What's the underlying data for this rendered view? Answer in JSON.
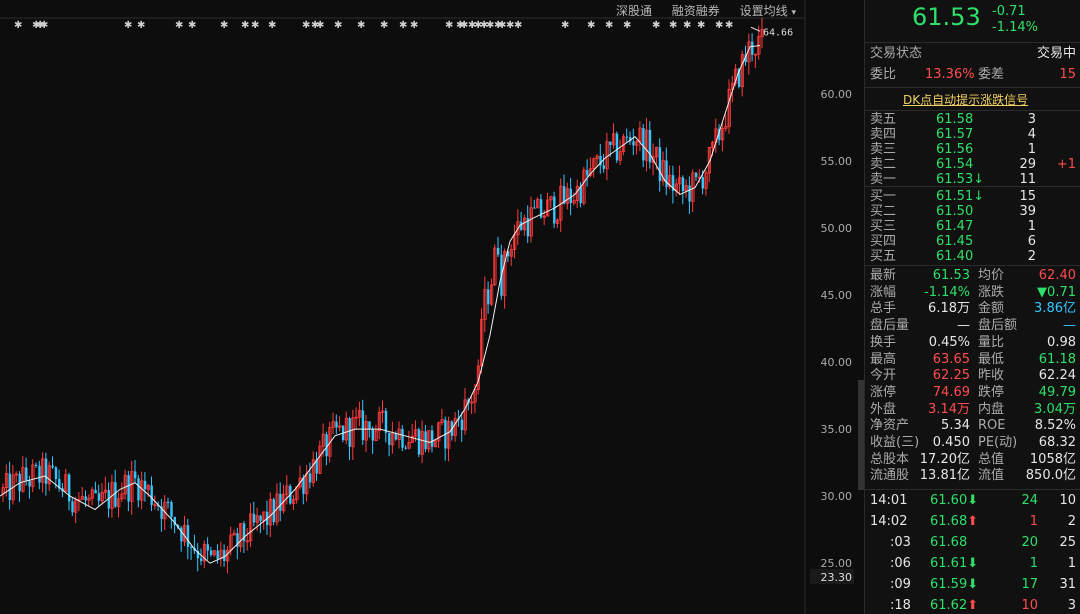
{
  "toolbar": {
    "links": [
      "深股通",
      "融资融券",
      "设置均线"
    ]
  },
  "chart_data": {
    "type": "candlestick",
    "y_ticks": [
      "60.00",
      "55.00",
      "50.00",
      "45.00",
      "40.00",
      "35.00",
      "30.00",
      "25.00"
    ],
    "y_min": 23.0,
    "y_max": 65.5,
    "low_label": "23.30",
    "high_label": "64.66",
    "ma_points": [
      [
        0,
        30.0
      ],
      [
        20,
        31.0
      ],
      [
        45,
        31.5
      ],
      [
        70,
        30.0
      ],
      [
        95,
        29.0
      ],
      [
        120,
        30.5
      ],
      [
        135,
        31.0
      ],
      [
        150,
        30.0
      ],
      [
        175,
        28.0
      ],
      [
        195,
        26.0
      ],
      [
        210,
        25.0
      ],
      [
        225,
        25.5
      ],
      [
        245,
        27.0
      ],
      [
        270,
        28.5
      ],
      [
        295,
        30.5
      ],
      [
        315,
        32.5
      ],
      [
        335,
        34.5
      ],
      [
        355,
        35.0
      ],
      [
        380,
        35.0
      ],
      [
        405,
        34.5
      ],
      [
        430,
        34.0
      ],
      [
        450,
        34.8
      ],
      [
        465,
        36.5
      ],
      [
        478,
        38.5
      ],
      [
        490,
        42.0
      ],
      [
        500,
        46.0
      ],
      [
        510,
        49.0
      ],
      [
        520,
        50.2
      ],
      [
        535,
        50.8
      ],
      [
        555,
        51.5
      ],
      [
        575,
        52.5
      ],
      [
        590,
        54.0
      ],
      [
        605,
        55.2
      ],
      [
        620,
        56.0
      ],
      [
        635,
        56.8
      ],
      [
        650,
        55.5
      ],
      [
        665,
        53.5
      ],
      [
        680,
        52.5
      ],
      [
        695,
        53.0
      ],
      [
        710,
        55.0
      ],
      [
        725,
        58.5
      ],
      [
        738,
        61.5
      ],
      [
        750,
        63.5
      ],
      [
        760,
        63.6
      ]
    ],
    "candles_seed": "rise-trend"
  },
  "quote": {
    "price": "61.53",
    "change": "-0.71",
    "change_pct": "-1.14%"
  },
  "status": {
    "label": "交易状态",
    "value": "交易中",
    "ratio_label": "委比",
    "ratio_value": "13.36%",
    "diff_label": "委差",
    "diff_value": "15"
  },
  "dk_signal": "DK点自动提示涨跌信号",
  "sell_orders": [
    {
      "label": "卖五",
      "price": "61.58",
      "vol": "3",
      "extra": ""
    },
    {
      "label": "卖四",
      "price": "61.57",
      "vol": "4",
      "extra": ""
    },
    {
      "label": "卖三",
      "price": "61.56",
      "vol": "1",
      "extra": ""
    },
    {
      "label": "卖二",
      "price": "61.54",
      "vol": "29",
      "extra": "+1"
    },
    {
      "label": "卖一",
      "price": "61.53↓",
      "vol": "11",
      "extra": ""
    }
  ],
  "buy_orders": [
    {
      "label": "买一",
      "price": "61.51↓",
      "vol": "15"
    },
    {
      "label": "买二",
      "price": "61.50",
      "vol": "39"
    },
    {
      "label": "买三",
      "price": "61.47",
      "vol": "1"
    },
    {
      "label": "买四",
      "price": "61.45",
      "vol": "6"
    },
    {
      "label": "买五",
      "price": "61.40",
      "vol": "2"
    }
  ],
  "stats": [
    [
      "最新",
      "61.53",
      "均价",
      "62.40"
    ],
    [
      "涨幅",
      "-1.14%",
      "涨跌",
      "▼0.71"
    ],
    [
      "总手",
      "6.18万",
      "金额",
      "3.86亿"
    ],
    [
      "盘后量",
      "—",
      "盘后额",
      "—"
    ],
    [
      "换手",
      "0.45%",
      "量比",
      "0.98"
    ],
    [
      "最高",
      "63.65",
      "最低",
      "61.18"
    ],
    [
      "今开",
      "62.25",
      "昨收",
      "62.24"
    ],
    [
      "涨停",
      "74.69",
      "跌停",
      "49.79"
    ],
    [
      "外盘",
      "3.14万",
      "内盘",
      "3.04万"
    ],
    [
      "净资产",
      "5.34",
      "ROE",
      "8.52%"
    ],
    [
      "收益(三)",
      "0.450",
      "PE(动)",
      "68.32"
    ],
    [
      "总股本",
      "17.20亿",
      "总值",
      "1058亿"
    ],
    [
      "流通股",
      "13.81亿",
      "流值",
      "850.0亿"
    ]
  ],
  "ticks": [
    {
      "time": "14:01",
      "price": "61.60",
      "arrow": "⬇",
      "vol": "24",
      "n": "10"
    },
    {
      "time": "14:02",
      "price": "61.68",
      "arrow": "⬆",
      "vol": "1",
      "n": "2"
    },
    {
      "time": ":03",
      "price": "61.68",
      "arrow": "",
      "vol": "20",
      "n": "25"
    },
    {
      "time": ":06",
      "price": "61.61",
      "arrow": "⬇",
      "vol": "1",
      "n": "1"
    },
    {
      "time": ":09",
      "price": "61.59",
      "arrow": "⬇",
      "vol": "17",
      "n": "31"
    },
    {
      "time": ":18",
      "price": "61.62",
      "arrow": "⬆",
      "vol": "10",
      "n": "3"
    }
  ]
}
